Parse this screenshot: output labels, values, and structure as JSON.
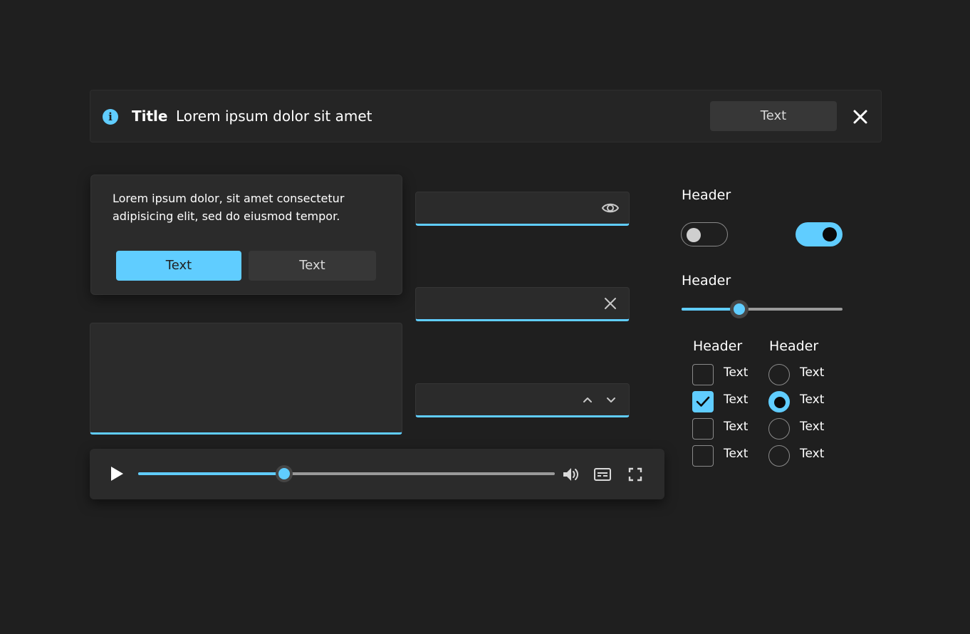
{
  "infobar": {
    "title": "Title",
    "message": "Lorem ipsum dolor sit amet",
    "action_label": "Text"
  },
  "dialog": {
    "body": "Lorem ipsum dolor, sit amet consectetur adipisicing elit, sed do eiusmod tempor.",
    "primary_label": "Text",
    "secondary_label": "Text"
  },
  "media_player": {
    "progress_fraction": 0.35
  },
  "toggles": {
    "header": "Header",
    "left_on": false,
    "right_on": true
  },
  "slider": {
    "header": "Header",
    "value_fraction": 0.36
  },
  "checkboxes": {
    "header": "Header",
    "items": [
      {
        "label": "Text",
        "checked": false
      },
      {
        "label": "Text",
        "checked": true
      },
      {
        "label": "Text",
        "checked": false
      },
      {
        "label": "Text",
        "checked": false
      }
    ]
  },
  "radios": {
    "header": "Header",
    "items": [
      {
        "label": "Text",
        "checked": false
      },
      {
        "label": "Text",
        "checked": true
      },
      {
        "label": "Text",
        "checked": false
      },
      {
        "label": "Text",
        "checked": false
      }
    ]
  },
  "colors": {
    "accent": "#60cdff",
    "background": "#1f1f1f",
    "surface": "#2b2b2b"
  },
  "icons": {
    "info": "info-icon",
    "close": "close-icon",
    "reveal_password": "eye-icon",
    "clear": "clear-icon",
    "spin_up": "chevron-up-icon",
    "spin_down": "chevron-down-icon",
    "play": "play-icon",
    "volume": "volume-icon",
    "captions": "captions-icon",
    "fullscreen": "fullscreen-icon",
    "check": "checkmark-icon"
  }
}
